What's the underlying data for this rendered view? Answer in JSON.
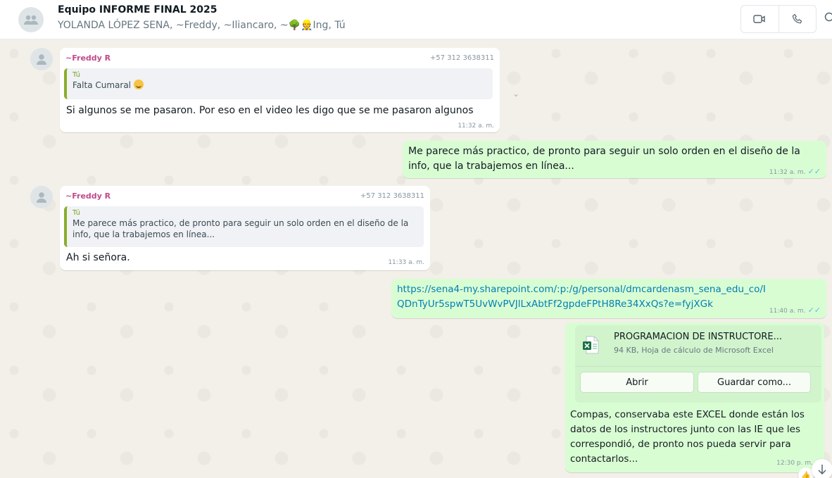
{
  "header": {
    "title": "Equipo INFORME FINAL 2025",
    "members": "YOLANDA LÓPEZ SENA, ~Freddy, ~Iliancaro, ~🌳👷Ing, Tú",
    "video_icon": "video-call-icon",
    "call_icon": "phone-call-icon",
    "search_icon": "search-icon"
  },
  "messages": [
    {
      "direction": "incoming",
      "sender": "~Freddy R",
      "phone": "+57 312 3638311",
      "quote_author": "Tú",
      "quote_text": "Falta Cumaral",
      "text": "Si algunos se me pasaron. Por eso en el video les digo que se me pasaron algunos",
      "time": "11:32 a. m."
    },
    {
      "direction": "outgoing",
      "text": "Me parece más practico, de pronto para seguir un solo orden en el diseño de la info, que la trabajemos en línea...",
      "time": "11:32 a. m."
    },
    {
      "direction": "incoming",
      "sender": "~Freddy R",
      "phone": "+57 312 3638311",
      "quote_author": "Tú",
      "quote_text": "Me parece más practico, de pronto para seguir un solo orden en el diseño de la info, que la trabajemos en línea...",
      "text": "Ah si señora.",
      "time": "11:33 a. m."
    },
    {
      "direction": "outgoing",
      "text": "https://sena4-my.sharepoint.com/:p:/g/personal/dmcardenasm_sena_edu_co/IQDnTyUr5spwT5UvWvPVJlLxAbtFf2gpdeFPtH8Re34XxQs?e=fyjXGk",
      "time": "11:40 a. m."
    },
    {
      "direction": "outgoing",
      "document": {
        "name": "PROGRAMACION DE INSTRUCTORE...",
        "meta": "94 KB, Hoja de cálculo de Microsoft Excel",
        "open_label": "Abrir",
        "save_label": "Guardar como..."
      },
      "text": "Compas, conservaba este EXCEL donde están los datos de los instructores junto con las IE que les correspondió, de pronto nos pueda servir para contactarlos...",
      "time": "12:30 p. m."
    }
  ],
  "colors": {
    "incoming_bubble": "#ffffff",
    "outgoing_bubble": "#d9fdd3",
    "sender_name": "#c0498b",
    "read_ticks": "#53bdeb",
    "link": "#027eb5",
    "chat_background": "#f3efe9"
  }
}
